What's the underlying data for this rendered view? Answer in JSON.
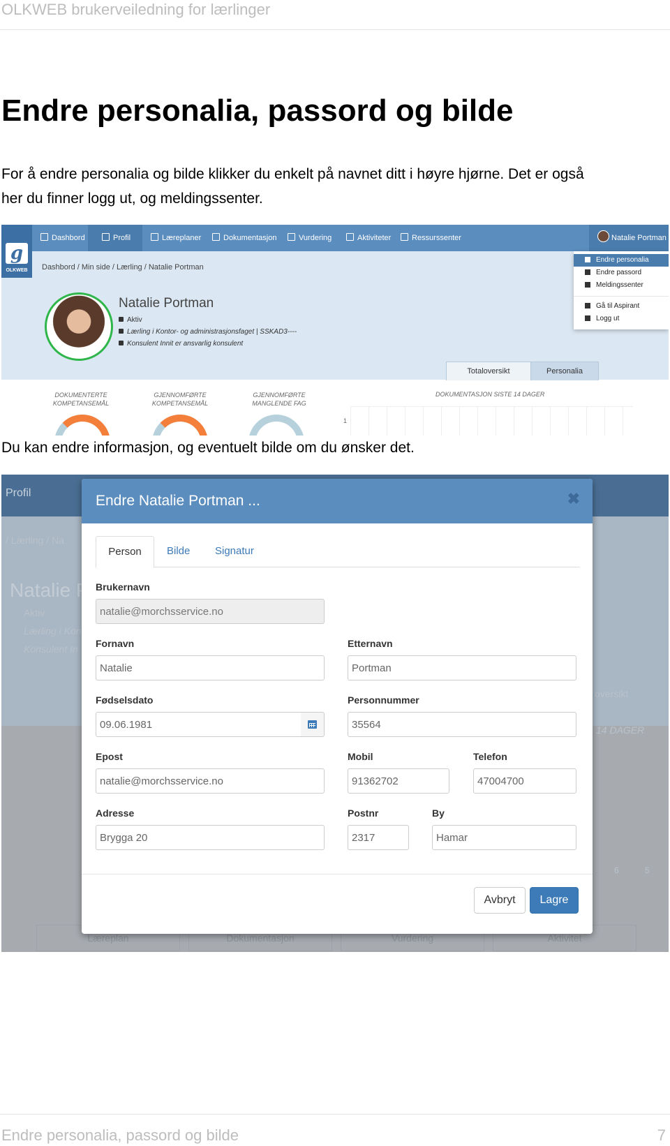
{
  "doc": {
    "header": "OLKWEB brukerveiledning for lærlinger",
    "title": "Endre personalia, passord og bilde",
    "para1_line1": "For å endre personalia og bilde klikker du enkelt på navnet ditt i høyre hjørne. Det er også",
    "para1_line2": "her du finner logg ut, og meldingssenter.",
    "para2": "Du kan endre informasjon, og eventuelt bilde om du ønsker det.",
    "footer_title": "Endre personalia, passord og bilde",
    "footer_page": "7"
  },
  "shot1": {
    "logo_text": "OLKWEB",
    "nav": [
      "Dashbord",
      "Profil",
      "Læreplaner",
      "Dokumentasjon",
      "Vurdering",
      "Aktiviteter",
      "Ressurssenter"
    ],
    "user_name": "Natalie Portman",
    "breadcrumb": "Dashbord  /   Min side  /   Lærling  /   Natalie Portman",
    "profile_name": "Natalie Portman",
    "status": "Aktiv",
    "line_laerling": "Lærling i Kontor- og administrasjonsfaget | SSKAD3----",
    "line_konsulent": "Konsulent Innit er ansvarlig konsulent",
    "menu": [
      "Endre personalia",
      "Endre passord",
      "Meldingssenter",
      "Gå til Aspirant",
      "Logg ut"
    ],
    "tabs": [
      "Totaloversikt",
      "Personalia"
    ],
    "stats": [
      {
        "l1": "DOKUMENTERTE",
        "l2": "KOMPETANSEMÅL"
      },
      {
        "l1": "GJENNOMFØRTE",
        "l2": "KOMPETANSEMÅL"
      },
      {
        "l1": "GJENNOMFØRTE",
        "l2": "MANGLENDE FAG"
      }
    ],
    "chart_label": "DOKUMENTASJON SISTE 14 DAGER",
    "chart_tick": "1"
  },
  "shot2": {
    "bg_nav": "Profil",
    "bg_bc": "/   Lærling   /   Na",
    "bg_name": "Natalie P",
    "bg_line1": "Aktiv",
    "bg_line2": "Lærling i Kon",
    "bg_line3": "Konsulent In",
    "bg_tab": "oversikt",
    "bg_chart": "14 DAGER",
    "bg_tick1": "6",
    "bg_tick2": "5",
    "bottom_tabs": [
      "Læreplan",
      "Dokumentasjon",
      "Vurdering",
      "Aktivitet"
    ],
    "modal_title": "Endre Natalie Portman ...",
    "close": "✖",
    "tabs": [
      "Person",
      "Bilde",
      "Signatur"
    ],
    "labels": {
      "brukernavn": "Brukernavn",
      "fornavn": "Fornavn",
      "etternavn": "Etternavn",
      "fodselsdato": "Fødselsdato",
      "personnummer": "Personnummer",
      "epost": "Epost",
      "mobil": "Mobil",
      "telefon": "Telefon",
      "adresse": "Adresse",
      "postnr": "Postnr",
      "by": "By"
    },
    "values": {
      "brukernavn": "natalie@morchsservice.no",
      "fornavn": "Natalie",
      "etternavn": "Portman",
      "fodselsdato": "09.06.1981",
      "personnummer": "35564",
      "epost": "natalie@morchsservice.no",
      "mobil": "91362702",
      "telefon": "47004700",
      "adresse": "Brygga 20",
      "postnr": "2317",
      "by": "Hamar"
    },
    "cancel": "Avbryt",
    "save": "Lagre"
  }
}
